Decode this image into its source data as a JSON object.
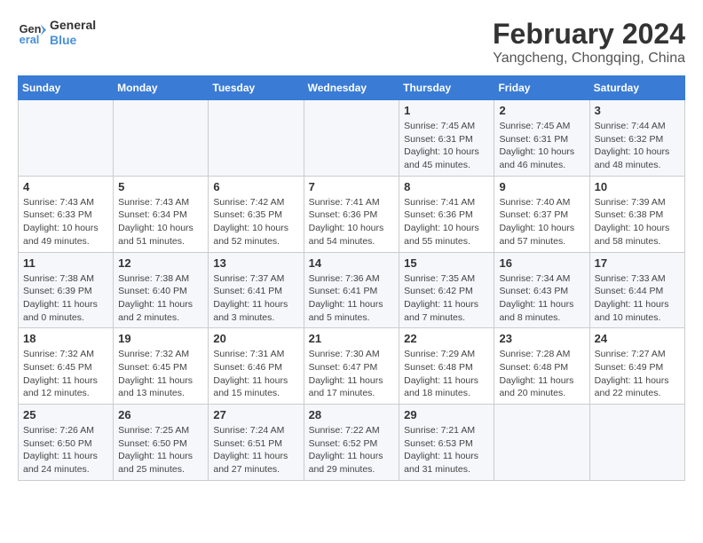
{
  "logo": {
    "line1": "General",
    "line2": "Blue"
  },
  "title": "February 2024",
  "subtitle": "Yangcheng, Chongqing, China",
  "days_of_week": [
    "Sunday",
    "Monday",
    "Tuesday",
    "Wednesday",
    "Thursday",
    "Friday",
    "Saturday"
  ],
  "weeks": [
    [
      {
        "day": "",
        "info": ""
      },
      {
        "day": "",
        "info": ""
      },
      {
        "day": "",
        "info": ""
      },
      {
        "day": "",
        "info": ""
      },
      {
        "day": "1",
        "info": "Sunrise: 7:45 AM\nSunset: 6:31 PM\nDaylight: 10 hours and 45 minutes."
      },
      {
        "day": "2",
        "info": "Sunrise: 7:45 AM\nSunset: 6:31 PM\nDaylight: 10 hours and 46 minutes."
      },
      {
        "day": "3",
        "info": "Sunrise: 7:44 AM\nSunset: 6:32 PM\nDaylight: 10 hours and 48 minutes."
      }
    ],
    [
      {
        "day": "4",
        "info": "Sunrise: 7:43 AM\nSunset: 6:33 PM\nDaylight: 10 hours and 49 minutes."
      },
      {
        "day": "5",
        "info": "Sunrise: 7:43 AM\nSunset: 6:34 PM\nDaylight: 10 hours and 51 minutes."
      },
      {
        "day": "6",
        "info": "Sunrise: 7:42 AM\nSunset: 6:35 PM\nDaylight: 10 hours and 52 minutes."
      },
      {
        "day": "7",
        "info": "Sunrise: 7:41 AM\nSunset: 6:36 PM\nDaylight: 10 hours and 54 minutes."
      },
      {
        "day": "8",
        "info": "Sunrise: 7:41 AM\nSunset: 6:36 PM\nDaylight: 10 hours and 55 minutes."
      },
      {
        "day": "9",
        "info": "Sunrise: 7:40 AM\nSunset: 6:37 PM\nDaylight: 10 hours and 57 minutes."
      },
      {
        "day": "10",
        "info": "Sunrise: 7:39 AM\nSunset: 6:38 PM\nDaylight: 10 hours and 58 minutes."
      }
    ],
    [
      {
        "day": "11",
        "info": "Sunrise: 7:38 AM\nSunset: 6:39 PM\nDaylight: 11 hours and 0 minutes."
      },
      {
        "day": "12",
        "info": "Sunrise: 7:38 AM\nSunset: 6:40 PM\nDaylight: 11 hours and 2 minutes."
      },
      {
        "day": "13",
        "info": "Sunrise: 7:37 AM\nSunset: 6:41 PM\nDaylight: 11 hours and 3 minutes."
      },
      {
        "day": "14",
        "info": "Sunrise: 7:36 AM\nSunset: 6:41 PM\nDaylight: 11 hours and 5 minutes."
      },
      {
        "day": "15",
        "info": "Sunrise: 7:35 AM\nSunset: 6:42 PM\nDaylight: 11 hours and 7 minutes."
      },
      {
        "day": "16",
        "info": "Sunrise: 7:34 AM\nSunset: 6:43 PM\nDaylight: 11 hours and 8 minutes."
      },
      {
        "day": "17",
        "info": "Sunrise: 7:33 AM\nSunset: 6:44 PM\nDaylight: 11 hours and 10 minutes."
      }
    ],
    [
      {
        "day": "18",
        "info": "Sunrise: 7:32 AM\nSunset: 6:45 PM\nDaylight: 11 hours and 12 minutes."
      },
      {
        "day": "19",
        "info": "Sunrise: 7:32 AM\nSunset: 6:45 PM\nDaylight: 11 hours and 13 minutes."
      },
      {
        "day": "20",
        "info": "Sunrise: 7:31 AM\nSunset: 6:46 PM\nDaylight: 11 hours and 15 minutes."
      },
      {
        "day": "21",
        "info": "Sunrise: 7:30 AM\nSunset: 6:47 PM\nDaylight: 11 hours and 17 minutes."
      },
      {
        "day": "22",
        "info": "Sunrise: 7:29 AM\nSunset: 6:48 PM\nDaylight: 11 hours and 18 minutes."
      },
      {
        "day": "23",
        "info": "Sunrise: 7:28 AM\nSunset: 6:48 PM\nDaylight: 11 hours and 20 minutes."
      },
      {
        "day": "24",
        "info": "Sunrise: 7:27 AM\nSunset: 6:49 PM\nDaylight: 11 hours and 22 minutes."
      }
    ],
    [
      {
        "day": "25",
        "info": "Sunrise: 7:26 AM\nSunset: 6:50 PM\nDaylight: 11 hours and 24 minutes."
      },
      {
        "day": "26",
        "info": "Sunrise: 7:25 AM\nSunset: 6:50 PM\nDaylight: 11 hours and 25 minutes."
      },
      {
        "day": "27",
        "info": "Sunrise: 7:24 AM\nSunset: 6:51 PM\nDaylight: 11 hours and 27 minutes."
      },
      {
        "day": "28",
        "info": "Sunrise: 7:22 AM\nSunset: 6:52 PM\nDaylight: 11 hours and 29 minutes."
      },
      {
        "day": "29",
        "info": "Sunrise: 7:21 AM\nSunset: 6:53 PM\nDaylight: 11 hours and 31 minutes."
      },
      {
        "day": "",
        "info": ""
      },
      {
        "day": "",
        "info": ""
      }
    ]
  ]
}
